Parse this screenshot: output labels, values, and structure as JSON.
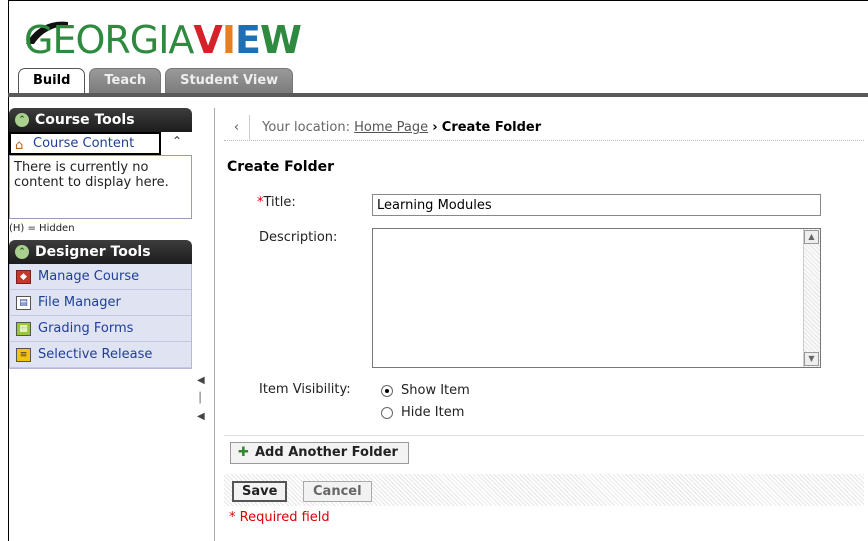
{
  "logo": {
    "text_part1": "GEORGIA",
    "text_part2": "VIEW"
  },
  "tabs": [
    {
      "label": "Build",
      "active": true
    },
    {
      "label": "Teach",
      "active": false
    },
    {
      "label": "Student View",
      "active": false
    }
  ],
  "sidebar": {
    "course_tools": {
      "title": "Course Tools",
      "collapse_icon": "double-chevron-up-icon"
    },
    "course_content": {
      "label": "Course Content",
      "icon": "home-icon",
      "empty_text": "There is currently no content to display here."
    },
    "hidden_note": "(H) = Hidden",
    "designer_tools": {
      "title": "Designer Tools",
      "items": [
        {
          "label": "Manage Course",
          "icon": "cube-icon"
        },
        {
          "label": "File Manager",
          "icon": "file-manager-icon"
        },
        {
          "label": "Grading Forms",
          "icon": "grading-forms-icon"
        },
        {
          "label": "Selective Release",
          "icon": "selective-release-icon"
        }
      ]
    }
  },
  "breadcrumb": {
    "prefix": "Your location:",
    "home": "Home Page",
    "separator": "›",
    "current": "Create Folder"
  },
  "form": {
    "heading": "Create Folder",
    "required_marker": "*",
    "title_label": "Title:",
    "title_value": "Learning Modules",
    "description_label": "Description:",
    "description_value": "",
    "visibility_label": "Item Visibility:",
    "visibility_options": [
      {
        "label": "Show Item",
        "selected": true
      },
      {
        "label": "Hide Item",
        "selected": false
      }
    ],
    "add_another_label": "Add Another Folder",
    "save_label": "Save",
    "cancel_label": "Cancel",
    "required_note": "* Required field"
  }
}
